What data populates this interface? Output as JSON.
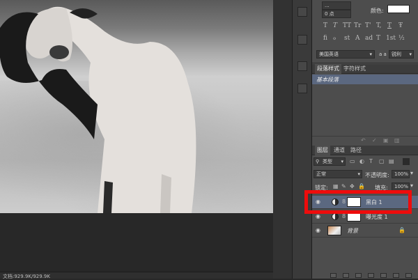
{
  "canvas": {
    "watermark": "",
    "status_text": "文档:929.9K/929.9K"
  },
  "character_panel": {
    "leading_value": "...",
    "tracking_value": "...",
    "baseline_value": "0 点",
    "color_label": "颜色:",
    "color_swatch": "#ffffff",
    "type_style_glyphs": [
      "T",
      "T",
      "TT",
      "Tr",
      "T'",
      "T,",
      "T",
      "Ŧ"
    ],
    "opentype_glyphs": [
      "fi",
      "ℴ",
      "st",
      "A",
      "ad",
      "T",
      "1st",
      "½"
    ],
    "language": "美国英语",
    "aa_icon": "a a",
    "aa_method": "锐利"
  },
  "paragraph_styles": {
    "tabs": [
      "段落样式",
      "字符样式"
    ],
    "items": [
      "基本段落"
    ]
  },
  "layers_panel": {
    "tabs": [
      "图层",
      "通道",
      "路径"
    ],
    "filter_kind": "类型",
    "blend_mode": "正常",
    "opacity_label": "不透明度:",
    "opacity_value": "100%",
    "lock_label": "锁定:",
    "fill_label": "填充:",
    "fill_value": "100%",
    "layers": [
      {
        "name": "黑白 1",
        "selected": true
      },
      {
        "name": "曝光度 1",
        "selected": false
      },
      {
        "name": "背景",
        "selected": false
      }
    ]
  },
  "colors": {
    "highlight": "#ee0c0c",
    "selected_layer": "#5b6880"
  }
}
